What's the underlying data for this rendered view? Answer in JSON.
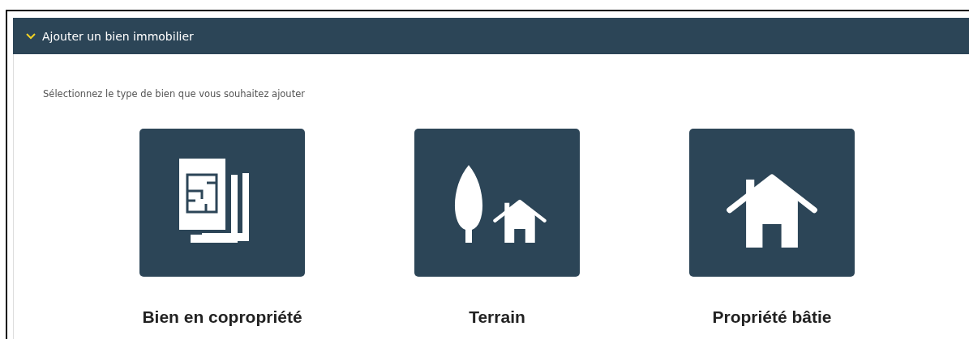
{
  "section": {
    "title": "Ajouter un bien immobilier",
    "expanded": true
  },
  "instruction": "Sélectionnez le type de bien que vous souhaitez ajouter",
  "property_types": [
    {
      "kind": "condo",
      "label": "Bien en copropriété"
    },
    {
      "kind": "land",
      "label": "Terrain"
    },
    {
      "kind": "house",
      "label": "Propriété bâtie"
    }
  ]
}
